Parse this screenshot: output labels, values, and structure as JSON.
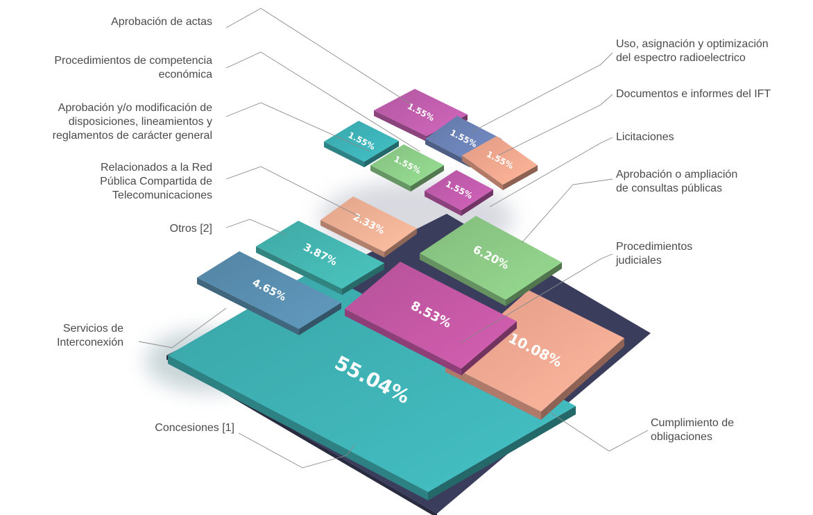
{
  "chart_data": {
    "type": "treemap",
    "title": "",
    "unit": "%",
    "items": [
      {
        "label": "Concesiones [1]",
        "value": 55.04,
        "value_label": "55.04%",
        "color": "#3fb3b6"
      },
      {
        "label": "Cumplimiento de obligaciones",
        "value": 10.08,
        "value_label": "10.08%",
        "color": "#f5aa93"
      },
      {
        "label": "Procedimientos judiciales",
        "value": 8.53,
        "value_label": "8.53%",
        "color": "#c558a5"
      },
      {
        "label": "Aprobación o ampliación de consultas públicas",
        "value": 6.2,
        "value_label": "6.20%",
        "color": "#8dcb87"
      },
      {
        "label": "Servicios de Interconexión",
        "value": 4.65,
        "value_label": "4.65%",
        "color": "#5a8fb1"
      },
      {
        "label": "Otros [2]",
        "value": 3.87,
        "value_label": "3.87%",
        "color": "#45b7b2"
      },
      {
        "label": "Relacionados a la Red Pública Compartida de Telecomunicaciones",
        "value": 2.33,
        "value_label": "2.33%",
        "color": "#f4b296"
      },
      {
        "label": "Aprobación de actas",
        "value": 1.55,
        "value_label": "1.55%",
        "color": "#c25fae"
      },
      {
        "label": "Uso, asignación y optimización del espectro radioelectrico",
        "value": 1.55,
        "value_label": "1.55%",
        "color": "#6c83b8"
      },
      {
        "label": "Aprobación y/o modificación de disposiciones, lineamientos y reglamentos de carácter general",
        "value": 1.55,
        "value_label": "1.55%",
        "color": "#3db4b9"
      },
      {
        "label": "Documentos e informes del IFT",
        "value": 1.55,
        "value_label": "1.55%",
        "color": "#f5a98f"
      },
      {
        "label": "Procedimientos de competencia económica",
        "value": 1.55,
        "value_label": "1.55%",
        "color": "#8ed08a"
      },
      {
        "label": "Licitaciones",
        "value": 1.55,
        "value_label": "1.55%",
        "color": "#c35cae"
      }
    ]
  },
  "labels": {
    "aprobacion_actas": "Aprobación de actas",
    "competencia_1": "Procedimientos de competencia",
    "competencia_2": "económica",
    "disposiciones_1": "Aprobación y/o modificación de",
    "disposiciones_2": "disposiciones, lineamientos y",
    "disposiciones_3": "reglamentos de carácter general",
    "red_1": "Relacionados a la Red",
    "red_2": "Pública Compartida de",
    "red_3": "Telecomunicaciones",
    "otros": "Otros  [2]",
    "interconexion_1": "Servicios de",
    "interconexion_2": "Interconexión",
    "concesiones": "Concesiones [1]",
    "espectro_1": "Uso, asignación y optimización",
    "espectro_2": "del espectro radioelectrico",
    "documentos": "Documentos e informes del IFT",
    "licitaciones": "Licitaciones",
    "consultas_1": "Aprobación o ampliación",
    "consultas_2": "de consultas públicas",
    "judiciales_1": "Procedimientos",
    "judiciales_2": "judiciales",
    "cumplimiento_1": "Cumplimiento de",
    "cumplimiento_2": "obligaciones"
  },
  "colors": {
    "base": "#3b3d5c",
    "leader": "#8a8a8a",
    "text": "#4a4a4a"
  }
}
